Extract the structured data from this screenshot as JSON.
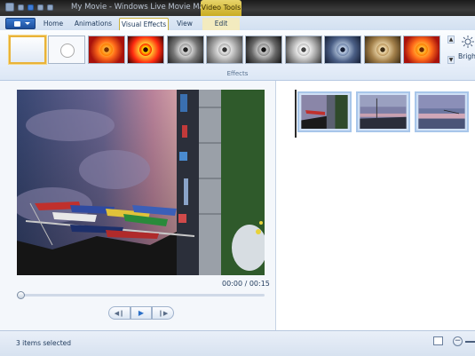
{
  "window": {
    "title": "My Movie - Windows Live Movie Maker",
    "context_tab": "Video Tools"
  },
  "ribbon": {
    "tabs": [
      {
        "label": "Home"
      },
      {
        "label": "Animations"
      },
      {
        "label": "Visual Effects"
      },
      {
        "label": "View"
      },
      {
        "label": "Edit"
      }
    ],
    "active_tab": "Visual Effects",
    "group_label": "Effects",
    "brightness_label": "Bright"
  },
  "preview": {
    "time": "00:00 / 00:15",
    "progress": 0.0
  },
  "status": {
    "text": "3 items selected"
  },
  "colors": {
    "accent": "#2a6fc7",
    "context_tab": "#d7be3b",
    "selection_border": "#e9b339"
  },
  "icons": [
    "save-icon",
    "undo-icon",
    "redo-icon",
    "brightness-icon",
    "play-icon",
    "rewind-icon",
    "forward-icon",
    "zoom-out-icon",
    "storyboard-icon"
  ]
}
